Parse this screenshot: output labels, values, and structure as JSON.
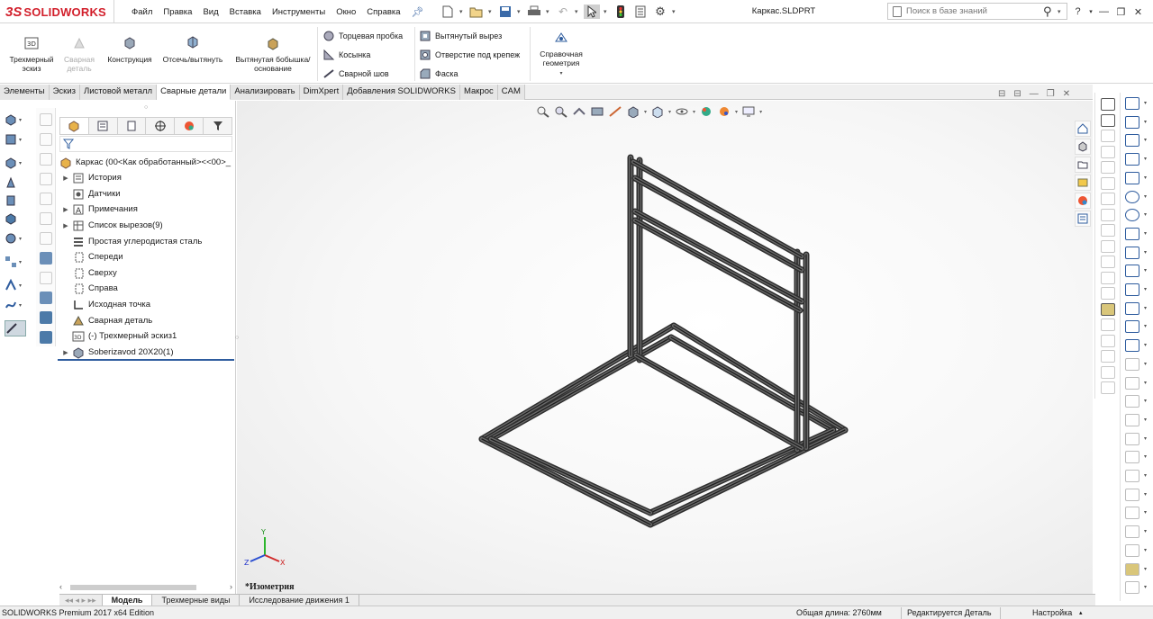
{
  "app": {
    "logo_prefix": "3S",
    "logo_text": "SOLIDWORKS",
    "document_title": "Каркас.SLDPRT",
    "menu": [
      "Файл",
      "Правка",
      "Вид",
      "Вставка",
      "Инструменты",
      "Окно",
      "Справка"
    ],
    "search_placeholder": "Поиск в базе знаний",
    "help_label": "?"
  },
  "ribbon": {
    "btn_3dsketch": "Трехмерный эскиз",
    "btn_weldment": "Сварная деталь",
    "btn_structure": "Конструкция",
    "btn_trim": "Отсечь/вытянуть",
    "btn_extrude": "Вытянутая бобышка/основание",
    "btn_endcap": "Торцевая пробка",
    "btn_gusset": "Косынка",
    "btn_weldbead": "Сварной шов",
    "btn_cut": "Вытянутый вырез",
    "btn_hole": "Отверстие под крепеж",
    "btn_chamfer": "Фаска",
    "btn_refgeom": "Справочная геометрия"
  },
  "tabs": [
    "Элементы",
    "Эскиз",
    "Листовой металл",
    "Сварные детали",
    "Анализировать",
    "DimXpert",
    "Добавления SOLIDWORKS",
    "Макрос",
    "CAM"
  ],
  "active_tab": "Сварные детали",
  "tree": {
    "root": "Каркас  (00<Как обработанный><<00>_",
    "items": [
      {
        "label": "История",
        "expandable": true
      },
      {
        "label": "Датчики",
        "expandable": false
      },
      {
        "label": "Примечания",
        "expandable": true
      },
      {
        "label": "Список вырезов(9)",
        "expandable": true
      },
      {
        "label": "Простая углеродистая сталь",
        "expandable": false
      },
      {
        "label": "Спереди",
        "expandable": false
      },
      {
        "label": "Сверху",
        "expandable": false
      },
      {
        "label": "Справа",
        "expandable": false
      },
      {
        "label": "Исходная точка",
        "expandable": false
      },
      {
        "label": "Сварная деталь",
        "expandable": false
      },
      {
        "label": "(-) Трехмерный эскиз1",
        "expandable": false
      },
      {
        "label": "Soberizavod 20X20(1)",
        "expandable": true
      }
    ]
  },
  "bottom_tabs": [
    "Модель",
    "Трехмерные виды",
    "Исследование движения 1"
  ],
  "active_bottom_tab": "Модель",
  "viewport": {
    "view_name": "*Изометрия",
    "triad_x": "X",
    "triad_y": "Y",
    "triad_z": "Z"
  },
  "status": {
    "edition": "SOLIDWORKS Premium 2017 x64 Edition",
    "total_length": "Общая длина: 2760мм",
    "editing": "Редактируется Деталь",
    "settings": "Настройка"
  },
  "colors": {
    "brand": "#d21f2b",
    "selection_blue": "#2e5c9e",
    "frame_dark": "#2f2f2f"
  }
}
